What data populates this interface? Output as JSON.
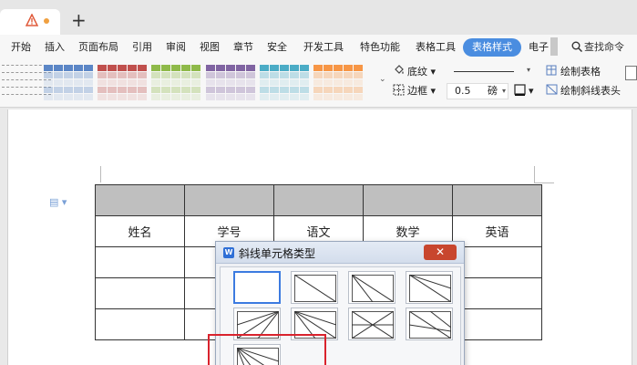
{
  "tabbar": {
    "new_tab_symbol": "+"
  },
  "menu": {
    "items": [
      "开始",
      "插入",
      "页面布局",
      "引用",
      "审阅",
      "视图",
      "章节",
      "安全",
      "开发工具",
      "特色功能",
      "表格工具",
      "表格样式",
      "电子"
    ],
    "active": "表格样式",
    "search_label": "查找命令"
  },
  "toolbar": {
    "shading_label": "底纹",
    "border_label": "边框",
    "line_width": "0.5",
    "line_width_unit": "磅",
    "draw_table_label": "绘制表格",
    "draw_diagonal_label": "绘制斜线表头",
    "style_colors": [
      "#5b86c6",
      "#c0504d",
      "#8fba4a",
      "#8064a2",
      "#4bacc6",
      "#f79646"
    ]
  },
  "table": {
    "header_row": [
      "",
      "",
      "",
      "",
      ""
    ],
    "label_row": [
      "姓名",
      "学号",
      "语文",
      "数学",
      "英语"
    ],
    "empty_rows": 3
  },
  "dialog": {
    "title": "斜线单元格类型",
    "logo": "W",
    "close_symbol": "✕"
  },
  "colors": {
    "accent": "#4a8de0",
    "highlight": "#d9232d",
    "table_header": "#bfbfbf"
  }
}
